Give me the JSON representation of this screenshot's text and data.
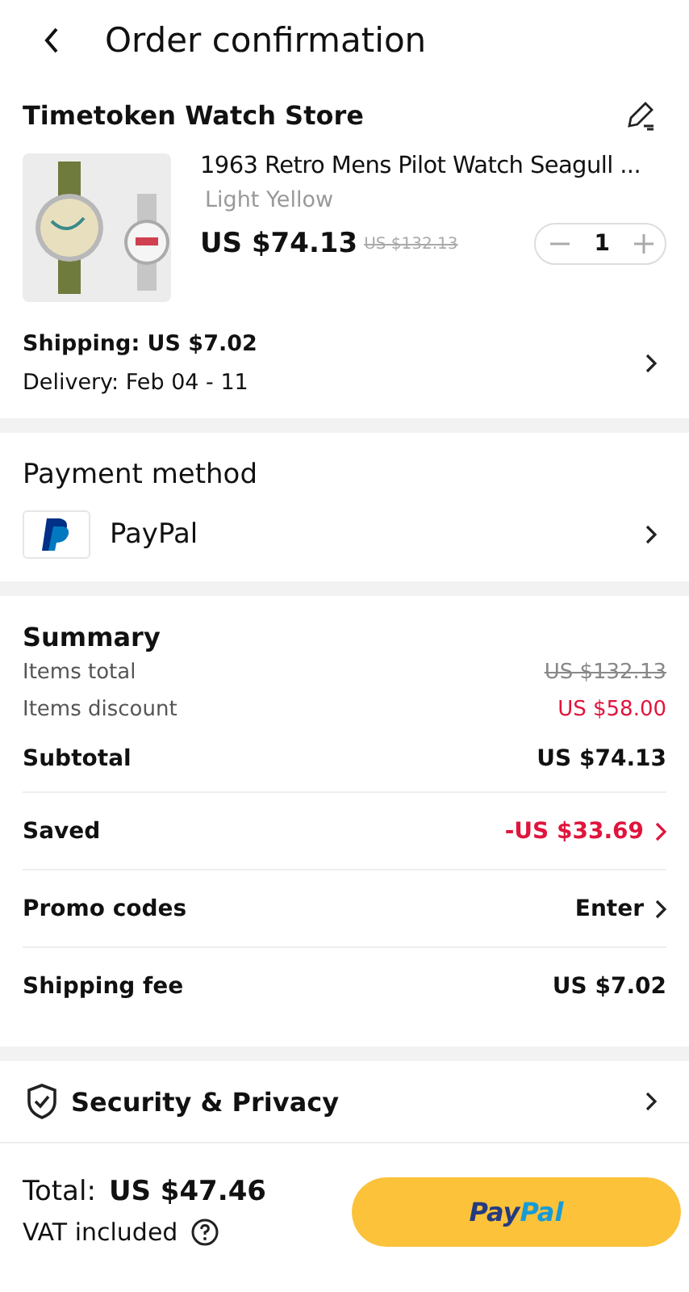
{
  "header": {
    "title": "Order confirmation"
  },
  "store": {
    "name": "Timetoken Watch Store",
    "product": {
      "title": "1963 Retro Mens Pilot Watch Seagull  ...",
      "variant": "Light Yellow",
      "price": "US $74.13",
      "original_price": "US $132.13",
      "quantity": "1"
    },
    "shipping": "Shipping: US $7.02",
    "delivery": "Delivery: Feb 04 - 11"
  },
  "payment": {
    "title": "Payment method",
    "method": "PayPal"
  },
  "summary": {
    "title": "Summary",
    "rows": [
      {
        "kind": "struck",
        "label": "Items total",
        "value": "US $132.13"
      },
      {
        "kind": "discount",
        "label": "Items discount",
        "value": "US $58.00"
      },
      {
        "kind": "bold",
        "label": "Subtotal",
        "value": "US $74.13"
      },
      {
        "kind": "saved",
        "label": "Saved",
        "value": "-US $33.69"
      },
      {
        "kind": "link",
        "label": "Promo codes",
        "value": "Enter"
      },
      {
        "kind": "bold",
        "label": "Shipping fee",
        "value": "US $7.02"
      }
    ]
  },
  "security": {
    "title": "Security & Privacy"
  },
  "footer": {
    "total_label": "Total:",
    "total": "US $47.46",
    "vat": "VAT included",
    "pay_button": {
      "label_parts": [
        "Pay",
        "Pal"
      ]
    }
  }
}
